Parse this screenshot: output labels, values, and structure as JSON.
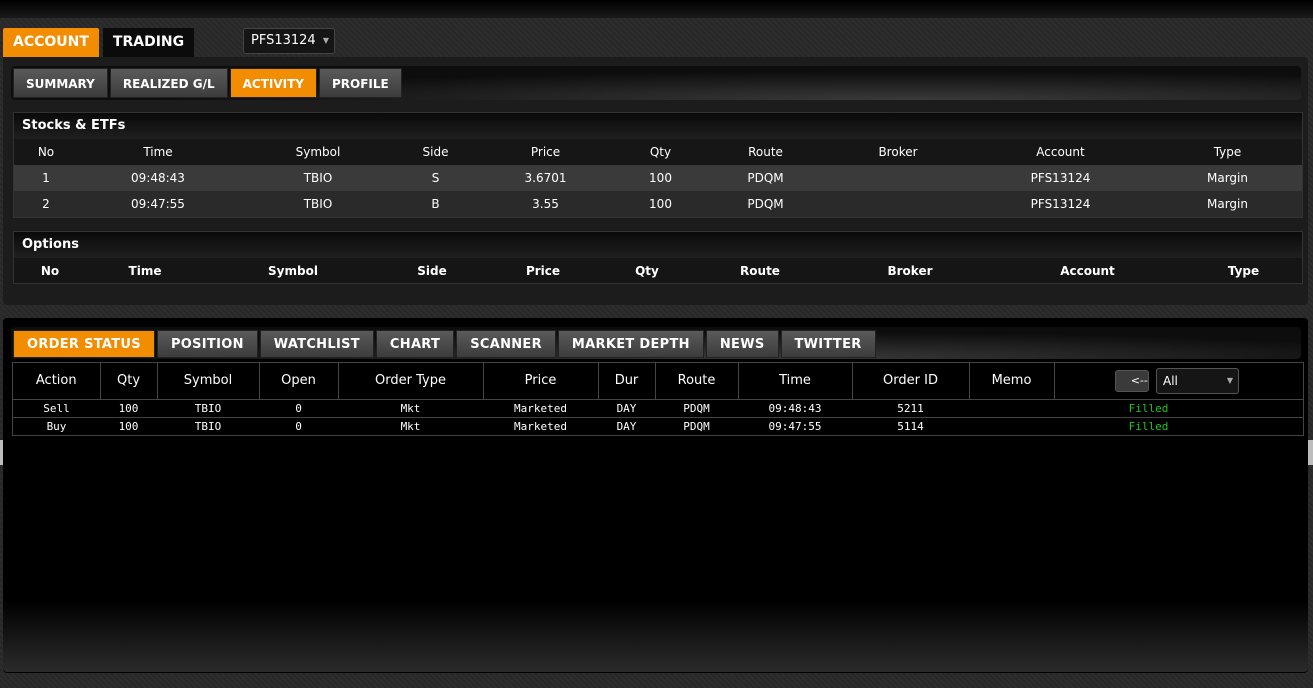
{
  "main_tabs": [
    {
      "label": "ACCOUNT",
      "active": true
    },
    {
      "label": "TRADING",
      "active": false
    }
  ],
  "account_select": {
    "value": "PFS13124"
  },
  "sub_tabs": [
    {
      "label": "SUMMARY",
      "active": false
    },
    {
      "label": "REALIZED G/L",
      "active": false
    },
    {
      "label": "ACTIVITY",
      "active": true
    },
    {
      "label": "PROFILE",
      "active": false
    }
  ],
  "stocks": {
    "title": "Stocks & ETFs",
    "columns": [
      "No",
      "Time",
      "Symbol",
      "Side",
      "Price",
      "Qty",
      "Route",
      "Broker",
      "Account",
      "Type"
    ],
    "rows": [
      [
        "1",
        "09:48:43",
        "TBIO",
        "S",
        "3.6701",
        "100",
        "PDQM",
        "",
        "PFS13124",
        "Margin"
      ],
      [
        "2",
        "09:47:55",
        "TBIO",
        "B",
        "3.55",
        "100",
        "PDQM",
        "",
        "PFS13124",
        "Margin"
      ]
    ]
  },
  "options": {
    "title": "Options",
    "columns": [
      "No",
      "Time",
      "Symbol",
      "Side",
      "Price",
      "Qty",
      "Route",
      "Broker",
      "Account",
      "Type"
    ]
  },
  "order_tabs": [
    {
      "label": "ORDER STATUS",
      "active": true
    },
    {
      "label": "POSITION",
      "active": false
    },
    {
      "label": "WATCHLIST",
      "active": false
    },
    {
      "label": "CHART",
      "active": false
    },
    {
      "label": "SCANNER",
      "active": false
    },
    {
      "label": "MARKET DEPTH",
      "active": false
    },
    {
      "label": "NEWS",
      "active": false
    },
    {
      "label": "TWITTER",
      "active": false
    }
  ],
  "orders": {
    "columns": [
      "Action",
      "Qty",
      "Symbol",
      "Open",
      "Order Type",
      "Price",
      "Dur",
      "Route",
      "Time",
      "Order ID",
      "Memo"
    ],
    "back_label": "<--",
    "filter_value": "All",
    "rows": [
      [
        "Sell",
        "100",
        "TBIO",
        "0",
        "Mkt",
        "Marketed",
        "DAY",
        "PDQM",
        "09:48:43",
        "5211",
        "",
        "Filled"
      ],
      [
        "Buy",
        "100",
        "TBIO",
        "0",
        "Mkt",
        "Marketed",
        "DAY",
        "PDQM",
        "09:47:55",
        "5114",
        "",
        "Filled"
      ]
    ]
  },
  "colors": {
    "accent": "#f28c00",
    "filled": "#22c322"
  }
}
